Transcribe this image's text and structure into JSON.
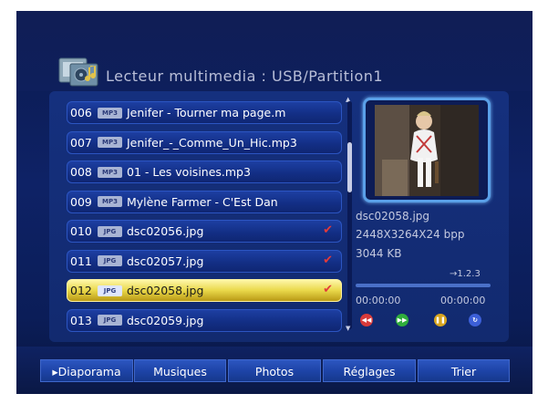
{
  "header": {
    "title": "Lecteur multimedia : USB/Partition1"
  },
  "file_list": {
    "items": [
      {
        "num": "006",
        "type": "MP3",
        "name": "Jenifer - Tourner ma page.m",
        "checked": false,
        "selected": false
      },
      {
        "num": "007",
        "type": "MP3",
        "name": "Jenifer_-_Comme_Un_Hic.mp3",
        "checked": false,
        "selected": false
      },
      {
        "num": "008",
        "type": "MP3",
        "name": "01 - Les voisines.mp3",
        "checked": false,
        "selected": false
      },
      {
        "num": "009",
        "type": "MP3",
        "name": "Mylène Farmer - C'Est Dan",
        "checked": false,
        "selected": false
      },
      {
        "num": "010",
        "type": "JPG",
        "name": "dsc02056.jpg",
        "checked": true,
        "selected": false
      },
      {
        "num": "011",
        "type": "JPG",
        "name": "dsc02057.jpg",
        "checked": true,
        "selected": false
      },
      {
        "num": "012",
        "type": "JPG",
        "name": "dsc02058.jpg",
        "checked": true,
        "selected": true
      },
      {
        "num": "013",
        "type": "JPG",
        "name": "dsc02059.jpg",
        "checked": false,
        "selected": false
      }
    ],
    "check_glyph": "✔"
  },
  "preview": {
    "filename": "dsc02058.jpg",
    "resolution": "2448X3264X24 bpp",
    "size": "3044 KB",
    "zoom": "→1.2.3",
    "progress": 0.0
  },
  "playback": {
    "elapsed": "00:00:00",
    "total": "00:00:00",
    "controls": [
      {
        "icon": "rewind-icon",
        "color": "#d83a3a",
        "glyph": "◀◀"
      },
      {
        "icon": "fast-forward-icon",
        "color": "#2fae3c",
        "glyph": "▶▶"
      },
      {
        "icon": "pause-icon",
        "color": "#d8a51e",
        "glyph": "❚❚"
      },
      {
        "icon": "repeat-icon",
        "color": "#3c5fd8",
        "glyph": "↻"
      }
    ]
  },
  "tabs": [
    {
      "label": "▸Diaporama"
    },
    {
      "label": "Musiques"
    },
    {
      "label": "Photos"
    },
    {
      "label": "Réglages"
    },
    {
      "label": "Trier"
    }
  ]
}
